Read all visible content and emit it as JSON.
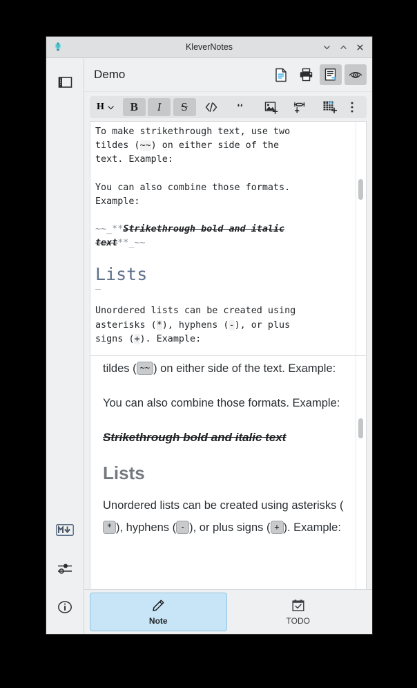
{
  "window": {
    "title": "KleverNotes",
    "app_icon": "lightbulb-icon",
    "controls": {
      "minimize": "∨",
      "maximize": "∧",
      "close": "✕"
    }
  },
  "left_rail": {
    "top_button": {
      "name": "toggle-note-list",
      "icon": "panel-left-icon"
    },
    "bottom_buttons": [
      {
        "name": "markdown-help",
        "icon": "markdown-icon",
        "label": "M↓"
      },
      {
        "name": "settings",
        "icon": "sliders-icon"
      },
      {
        "name": "about",
        "icon": "info-icon"
      }
    ]
  },
  "header": {
    "sidebar_toggle_icon": "show-sidebar-icon",
    "document_title": "Demo",
    "actions": [
      {
        "name": "new-document-button",
        "icon": "document-icon",
        "active": false
      },
      {
        "name": "print-button",
        "icon": "printer-icon",
        "active": false
      },
      {
        "name": "toggle-editor-button",
        "icon": "editor-view-icon",
        "active": true
      },
      {
        "name": "toggle-preview-button",
        "icon": "eye-icon",
        "active": true
      }
    ]
  },
  "toolbar": {
    "heading_label": "H",
    "buttons": [
      {
        "name": "heading-select",
        "label": "H",
        "icon": "chevron-down-icon",
        "active": false
      },
      {
        "name": "bold-button",
        "label": "B",
        "icon": "bold-icon",
        "active": true
      },
      {
        "name": "italic-button",
        "label": "I",
        "icon": "italic-icon",
        "active": true
      },
      {
        "name": "strikethrough-button",
        "label": "S",
        "icon": "strikethrough-icon",
        "active": true
      },
      {
        "name": "code-block-button",
        "label": "</>",
        "icon": "code-icon",
        "active": false
      },
      {
        "name": "quote-button",
        "label": "“",
        "icon": "quote-icon",
        "active": false
      },
      {
        "name": "insert-image-button",
        "icon": "image-add-icon",
        "active": false
      },
      {
        "name": "insert-link-button",
        "icon": "link-add-icon",
        "active": false
      },
      {
        "name": "insert-table-button",
        "icon": "table-add-icon",
        "active": false
      },
      {
        "name": "more-options-button",
        "label": "⋮",
        "icon": "kebab-menu-icon",
        "active": false
      }
    ]
  },
  "editor": {
    "blocks": [
      {
        "type": "paragraph",
        "lines": [
          [
            {
              "t": "text",
              "v": "To make strikethrough text, use two"
            }
          ],
          [
            {
              "t": "text",
              "v": "tildes ("
            },
            {
              "t": "code",
              "v": "~~"
            },
            {
              "t": "text",
              "v": ") on either side of the"
            }
          ],
          [
            {
              "t": "text",
              "v": "text. Example:"
            }
          ]
        ]
      },
      {
        "type": "paragraph",
        "lines": [
          [
            {
              "t": "text",
              "v": "You can also combine those formats."
            }
          ],
          [
            {
              "t": "text",
              "v": "Example:"
            }
          ]
        ]
      },
      {
        "type": "paragraph",
        "lines": [
          [
            {
              "t": "mark",
              "v": "~~_**"
            },
            {
              "t": "fmt",
              "v": "Strikethrough bold and italic"
            }
          ],
          [
            {
              "t": "fmt",
              "v": "text"
            },
            {
              "t": "mark",
              "v": "**_~~"
            }
          ]
        ]
      },
      {
        "type": "heading",
        "text": "Lists",
        "rule": "—"
      },
      {
        "type": "paragraph",
        "lines": [
          [
            {
              "t": "text",
              "v": "Unordered lists can be created using"
            }
          ],
          [
            {
              "t": "text",
              "v": "asterisks ("
            },
            {
              "t": "code",
              "v": "*"
            },
            {
              "t": "text",
              "v": "), hyphens ("
            },
            {
              "t": "code",
              "v": "-"
            },
            {
              "t": "text",
              "v": "), or plus"
            }
          ],
          [
            {
              "t": "text",
              "v": "signs ("
            },
            {
              "t": "code",
              "v": "+"
            },
            {
              "t": "text",
              "v": "). Example:"
            }
          ]
        ]
      }
    ],
    "scroll_thumb": {
      "top_pct": 24,
      "height_pct": 9
    }
  },
  "preview": {
    "blocks": [
      {
        "type": "paragraph",
        "parts": [
          {
            "t": "text",
            "v": "tildes ("
          },
          {
            "t": "kbd",
            "v": "~~"
          },
          {
            "t": "text",
            "v": ") on either side of the text. Example:"
          }
        ]
      },
      {
        "type": "paragraph",
        "parts": [
          {
            "t": "text",
            "v": "You can also combine those formats. Example:"
          }
        ]
      },
      {
        "type": "strike-paragraph",
        "parts": [
          {
            "t": "fmt",
            "v": "Strikethrough bold and italic text"
          }
        ]
      },
      {
        "type": "heading",
        "parts": [
          {
            "t": "text",
            "v": "Lists"
          }
        ]
      },
      {
        "type": "paragraph",
        "parts": [
          {
            "t": "text",
            "v": "Unordered lists can be created using asterisks ("
          },
          {
            "t": "kbd",
            "v": "*"
          },
          {
            "t": "text",
            "v": "), hyphens ("
          },
          {
            "t": "kbd",
            "v": "-"
          },
          {
            "t": "text",
            "v": "), or plus signs ("
          },
          {
            "t": "kbd",
            "v": "+"
          },
          {
            "t": "text",
            "v": "). Example:"
          }
        ]
      }
    ],
    "scroll_thumb": {
      "top_pct": 26,
      "height_pct": 9
    }
  },
  "bottom_tabs": [
    {
      "name": "tab-note",
      "label": "Note",
      "icon": "pencil-icon",
      "selected": true
    },
    {
      "name": "tab-todo",
      "label": "TODO",
      "icon": "calendar-check-icon",
      "selected": false
    }
  ],
  "colors": {
    "accent": "#3daee9",
    "selected_tab_bg": "#c7e5f7",
    "chrome_bg": "#eff0f1",
    "heading": "#73797f",
    "editor_heading": "#5d7089"
  }
}
